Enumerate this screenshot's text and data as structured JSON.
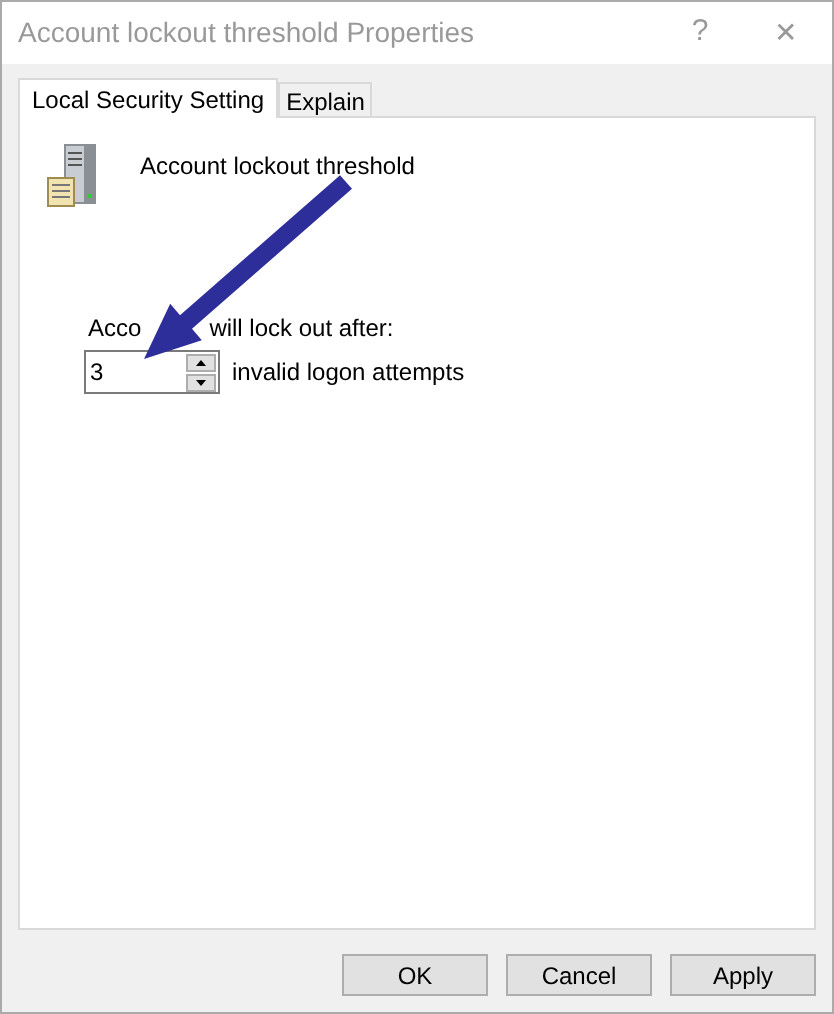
{
  "window": {
    "title": "Account lockout threshold Properties",
    "help": "?",
    "close": "✕"
  },
  "tabs": [
    {
      "label": "Local Security Setting",
      "selected": true
    },
    {
      "label": "Explain",
      "selected": false
    }
  ],
  "setting": {
    "name": "Account lockout threshold",
    "field_label_parts": [
      "Acco",
      "will lock out after:"
    ],
    "value": "3",
    "unit": "invalid logon attempts"
  },
  "buttons": [
    "OK",
    "Cancel",
    "Apply"
  ]
}
